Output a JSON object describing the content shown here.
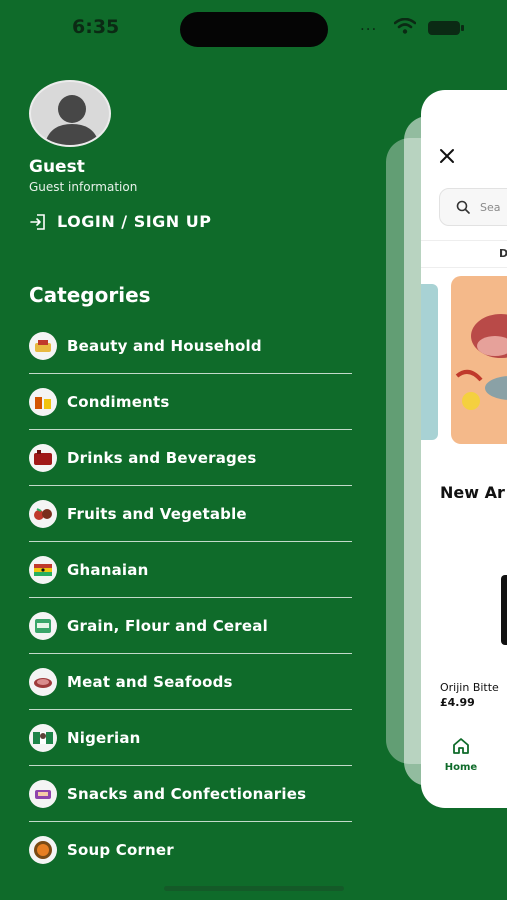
{
  "status_bar": {
    "time": "6:35",
    "dots": "..."
  },
  "profile": {
    "name": "Guest",
    "info": "Guest information",
    "login_label": "LOGIN / SIGN UP"
  },
  "categories": {
    "heading": "Categories",
    "items": [
      {
        "label": "Beauty and Household"
      },
      {
        "label": "Condiments"
      },
      {
        "label": "Drinks and Beverages"
      },
      {
        "label": "Fruits and Vegetable"
      },
      {
        "label": "Ghanaian"
      },
      {
        "label": "Grain, Flour and Cereal"
      },
      {
        "label": "Meat and Seafoods"
      },
      {
        "label": "Nigerian"
      },
      {
        "label": "Snacks and Confectionaries"
      },
      {
        "label": "Soup Corner"
      }
    ]
  },
  "preview": {
    "search_placeholder": "Sea",
    "tab_letter": "D",
    "section_title": "New Ar",
    "product_name": "Orijin Bitte",
    "product_price": "£4.99",
    "nav_home": "Home"
  },
  "colors": {
    "background": "#0f6b2a",
    "accent": "#0f6b2a"
  }
}
